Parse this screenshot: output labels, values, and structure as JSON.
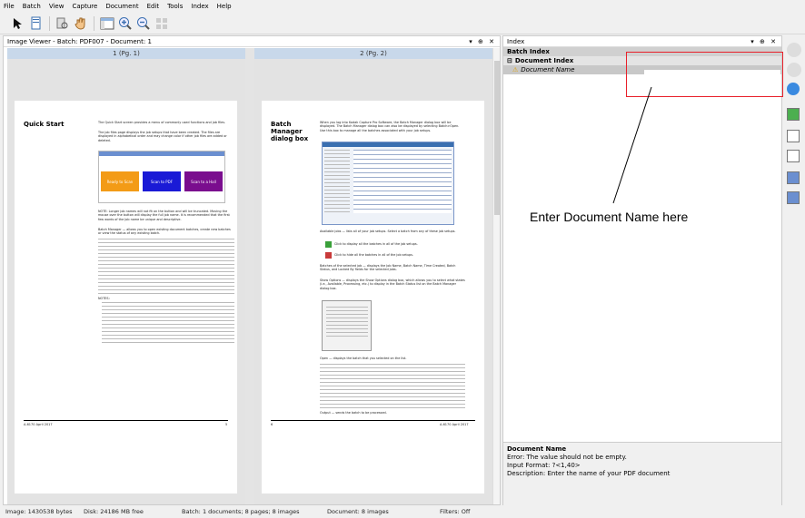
{
  "menu": [
    "File",
    "Batch",
    "View",
    "Capture",
    "Document",
    "Edit",
    "Tools",
    "Index",
    "Help"
  ],
  "viewer": {
    "title": "Image Viewer - Batch: PDF007 - Document: 1",
    "controls": "▾ ⊕ ✕"
  },
  "pages": [
    {
      "label": "1 (Pg. 1)",
      "heading": "Quick Start",
      "footer_left": "A-6170 April 2017",
      "footer_right": "5"
    },
    {
      "label": "2 (Pg. 2)",
      "heading": "Batch Manager dialog box",
      "footer_left": "6",
      "footer_right": "A-6170 April 2017"
    }
  ],
  "page1_text": {
    "intro": "The Quick Start screen provides a menu of commonly used functions and job files.",
    "intro2": "The job files page displays the job setups that have been created. The files are displayed in alphabetical order and may change color if other job files are added or deleted.",
    "tiles": [
      "Ready to Scan",
      "Scan to PDF",
      "Scan to a Hall"
    ],
    "note": "NOTE: Longer job names will not fit on the button and will be truncated. Moving the mouse over the button will display the full job name. It is recommended that the first few words of the Job name be unique and descriptive.",
    "body": "Batch Manager — allows you to open existing document batches, create new batches or view the status of any existing batch.",
    "notes_title": "NOTES:"
  },
  "page2_text": {
    "intro": "When you log into Kodak Capture Pro Software, the Batch Manager dialog box will be displayed. The Batch Manager dialog box can also be displayed by selecting Batch>Open. Use this box to manage all the batches associated with your job setups.",
    "available": "Available jobs — lists all of your job setups. Select a batch from any of these job setups.",
    "click1": "Click to display all the batches in all of the job setups.",
    "click2": "Click to hide all the batches in all of the job setups.",
    "batches": "Batches of the selected job — displays the Job Name, Batch Name, Time Created, Batch Status, and Locked By fields for the selected jobs.",
    "show": "Show Options — displays the Show Options dialog box, which allows you to select what states (i.e., Available, Processing, etc.) to display in the Batch Status list on the Batch Manager dialog box.",
    "open": "Open — displays the batch that you selected on the list.",
    "output": "Output — sends the batch to be processed."
  },
  "index": {
    "title": "Index",
    "controls": "▾ ⊕ ✕",
    "batch_index": "Batch Index",
    "document_index": "Document Index",
    "field_name": "Document Name",
    "field_value": "",
    "desc_title": "Document Name",
    "desc_lines": [
      "Error: The value should not be empty.",
      "Input Format: ?<1,40>",
      "Description: Enter the name of your PDF document"
    ]
  },
  "annotation": "Enter Document Name here",
  "status": {
    "image": "Image: 1430538 bytes",
    "disk": "Disk: 24186 MB free",
    "batch": "Batch: 1 documents; 8 pages; 8 images",
    "document": "Document: 8 images",
    "filters": "Filters: Off"
  },
  "colors": {
    "accent": "#e8202a",
    "tile1": "#f39b16",
    "tile2": "#1a1ad6",
    "tile3": "#7a0d8e"
  }
}
